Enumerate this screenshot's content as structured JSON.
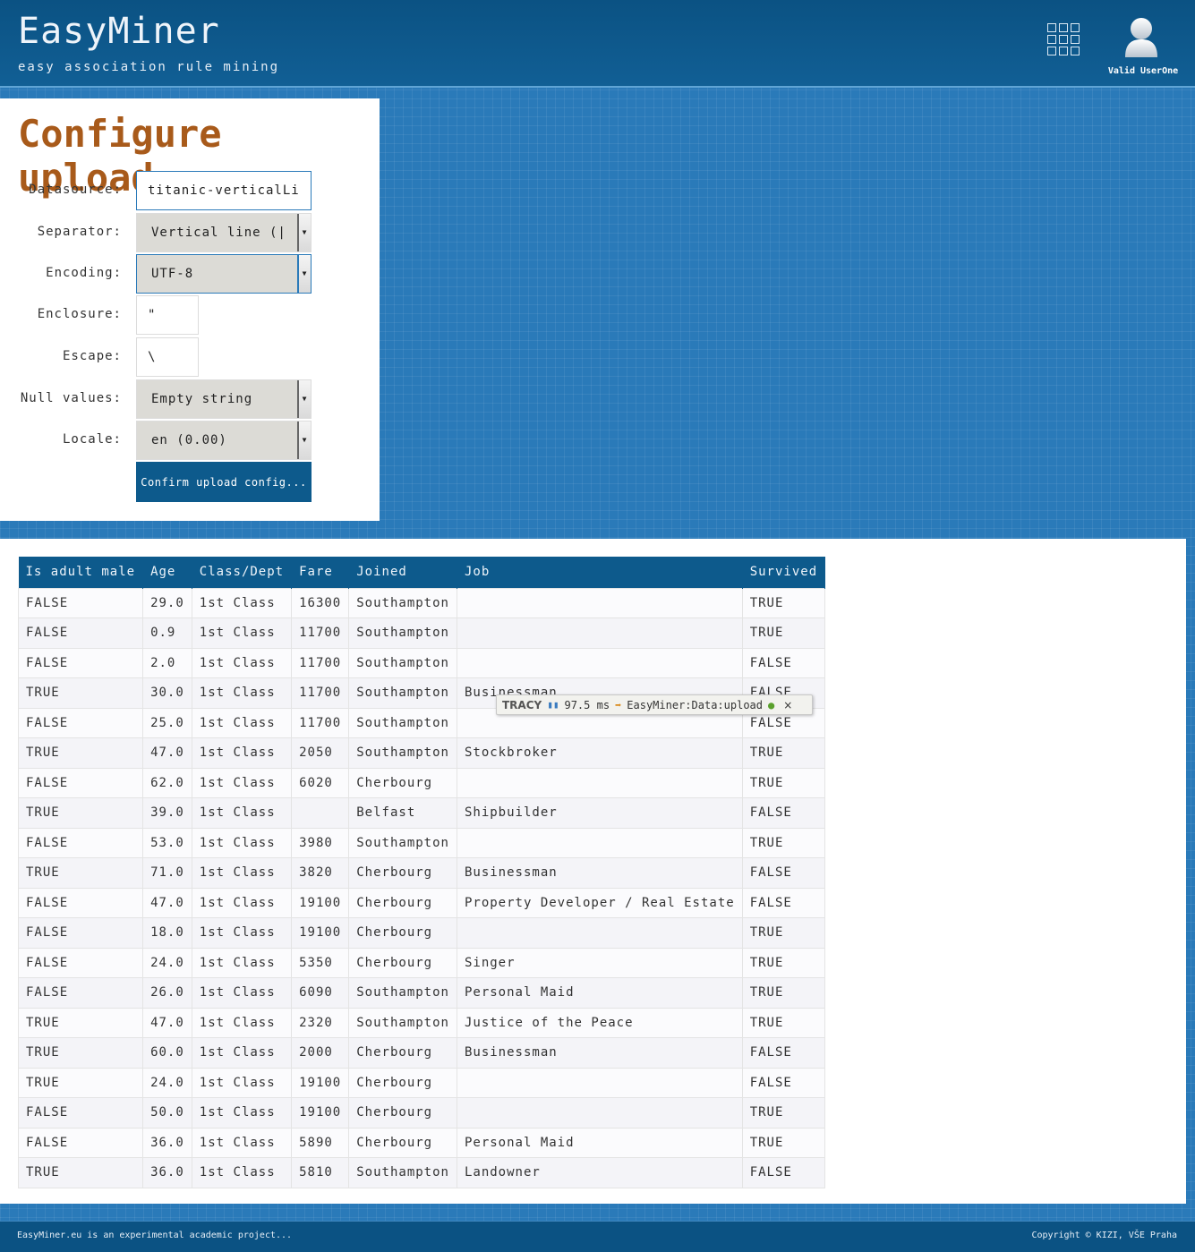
{
  "header": {
    "logo": "EasyMiner",
    "tagline": "easy association rule mining",
    "apps_icon": "grid-apps-icon",
    "user_icon": "user-avatar-icon",
    "user_name": "Valid UserOne"
  },
  "config": {
    "title": "Configure upload",
    "datasource": {
      "label": "Datasource:",
      "value": "titanic-verticalLine"
    },
    "separator": {
      "label": "Separator:",
      "value": "Vertical line (|)"
    },
    "encoding": {
      "label": "Encoding:",
      "value": "UTF-8"
    },
    "enclosure": {
      "label": "Enclosure:",
      "value": "\""
    },
    "escape": {
      "label": "Escape:",
      "value": "\\"
    },
    "null_values": {
      "label": "Null values:",
      "value": "Empty string"
    },
    "locale": {
      "label": "Locale:",
      "value": "en (0.00)"
    },
    "confirm_label": "Confirm upload config..."
  },
  "preview": {
    "columns": [
      "Is adult male",
      "Age",
      "Class/Dept",
      "Fare",
      "Joined",
      "Job",
      "Survived"
    ],
    "rows": [
      [
        "FALSE",
        "29.0",
        "1st Class",
        "16300",
        "Southampton",
        "",
        "TRUE"
      ],
      [
        "FALSE",
        "0.9",
        "1st Class",
        "11700",
        "Southampton",
        "",
        "TRUE"
      ],
      [
        "FALSE",
        "2.0",
        "1st Class",
        "11700",
        "Southampton",
        "",
        "FALSE"
      ],
      [
        "TRUE",
        "30.0",
        "1st Class",
        "11700",
        "Southampton",
        "Businessman",
        "FALSE"
      ],
      [
        "FALSE",
        "25.0",
        "1st Class",
        "11700",
        "Southampton",
        "",
        "FALSE"
      ],
      [
        "TRUE",
        "47.0",
        "1st Class",
        "2050",
        "Southampton",
        "Stockbroker",
        "TRUE"
      ],
      [
        "FALSE",
        "62.0",
        "1st Class",
        "6020",
        "Cherbourg",
        "",
        "TRUE"
      ],
      [
        "TRUE",
        "39.0",
        "1st Class",
        "",
        "Belfast",
        "Shipbuilder",
        "FALSE"
      ],
      [
        "FALSE",
        "53.0",
        "1st Class",
        "3980",
        "Southampton",
        "",
        "TRUE"
      ],
      [
        "TRUE",
        "71.0",
        "1st Class",
        "3820",
        "Cherbourg",
        "Businessman",
        "FALSE"
      ],
      [
        "FALSE",
        "47.0",
        "1st Class",
        "19100",
        "Cherbourg",
        "Property Developer / Real Estate",
        "FALSE"
      ],
      [
        "FALSE",
        "18.0",
        "1st Class",
        "19100",
        "Cherbourg",
        "",
        "TRUE"
      ],
      [
        "FALSE",
        "24.0",
        "1st Class",
        "5350",
        "Cherbourg",
        "Singer",
        "TRUE"
      ],
      [
        "FALSE",
        "26.0",
        "1st Class",
        "6090",
        "Southampton",
        "Personal Maid",
        "TRUE"
      ],
      [
        "TRUE",
        "47.0",
        "1st Class",
        "2320",
        "Southampton",
        "Justice of the Peace",
        "TRUE"
      ],
      [
        "TRUE",
        "60.0",
        "1st Class",
        "2000",
        "Cherbourg",
        "Businessman",
        "FALSE"
      ],
      [
        "TRUE",
        "24.0",
        "1st Class",
        "19100",
        "Cherbourg",
        "",
        "FALSE"
      ],
      [
        "FALSE",
        "50.0",
        "1st Class",
        "19100",
        "Cherbourg",
        "",
        "TRUE"
      ],
      [
        "FALSE",
        "36.0",
        "1st Class",
        "5890",
        "Cherbourg",
        "Personal Maid",
        "TRUE"
      ],
      [
        "TRUE",
        "36.0",
        "1st Class",
        "5810",
        "Southampton",
        "Landowner",
        "FALSE"
      ]
    ]
  },
  "tracy": {
    "label": "TRACY",
    "time": "97.5 ms",
    "route": "EasyMiner:Data:upload",
    "close": "×"
  },
  "footer": {
    "left": "EasyMiner.eu is an experimental academic project...",
    "right": "Copyright © KIZI, VŠE Praha"
  },
  "colors": {
    "header_bg": "#0b5283",
    "page_bg": "#2a7ab9",
    "title_brown": "#a85a1a",
    "button_bg": "#0d5a8c"
  }
}
